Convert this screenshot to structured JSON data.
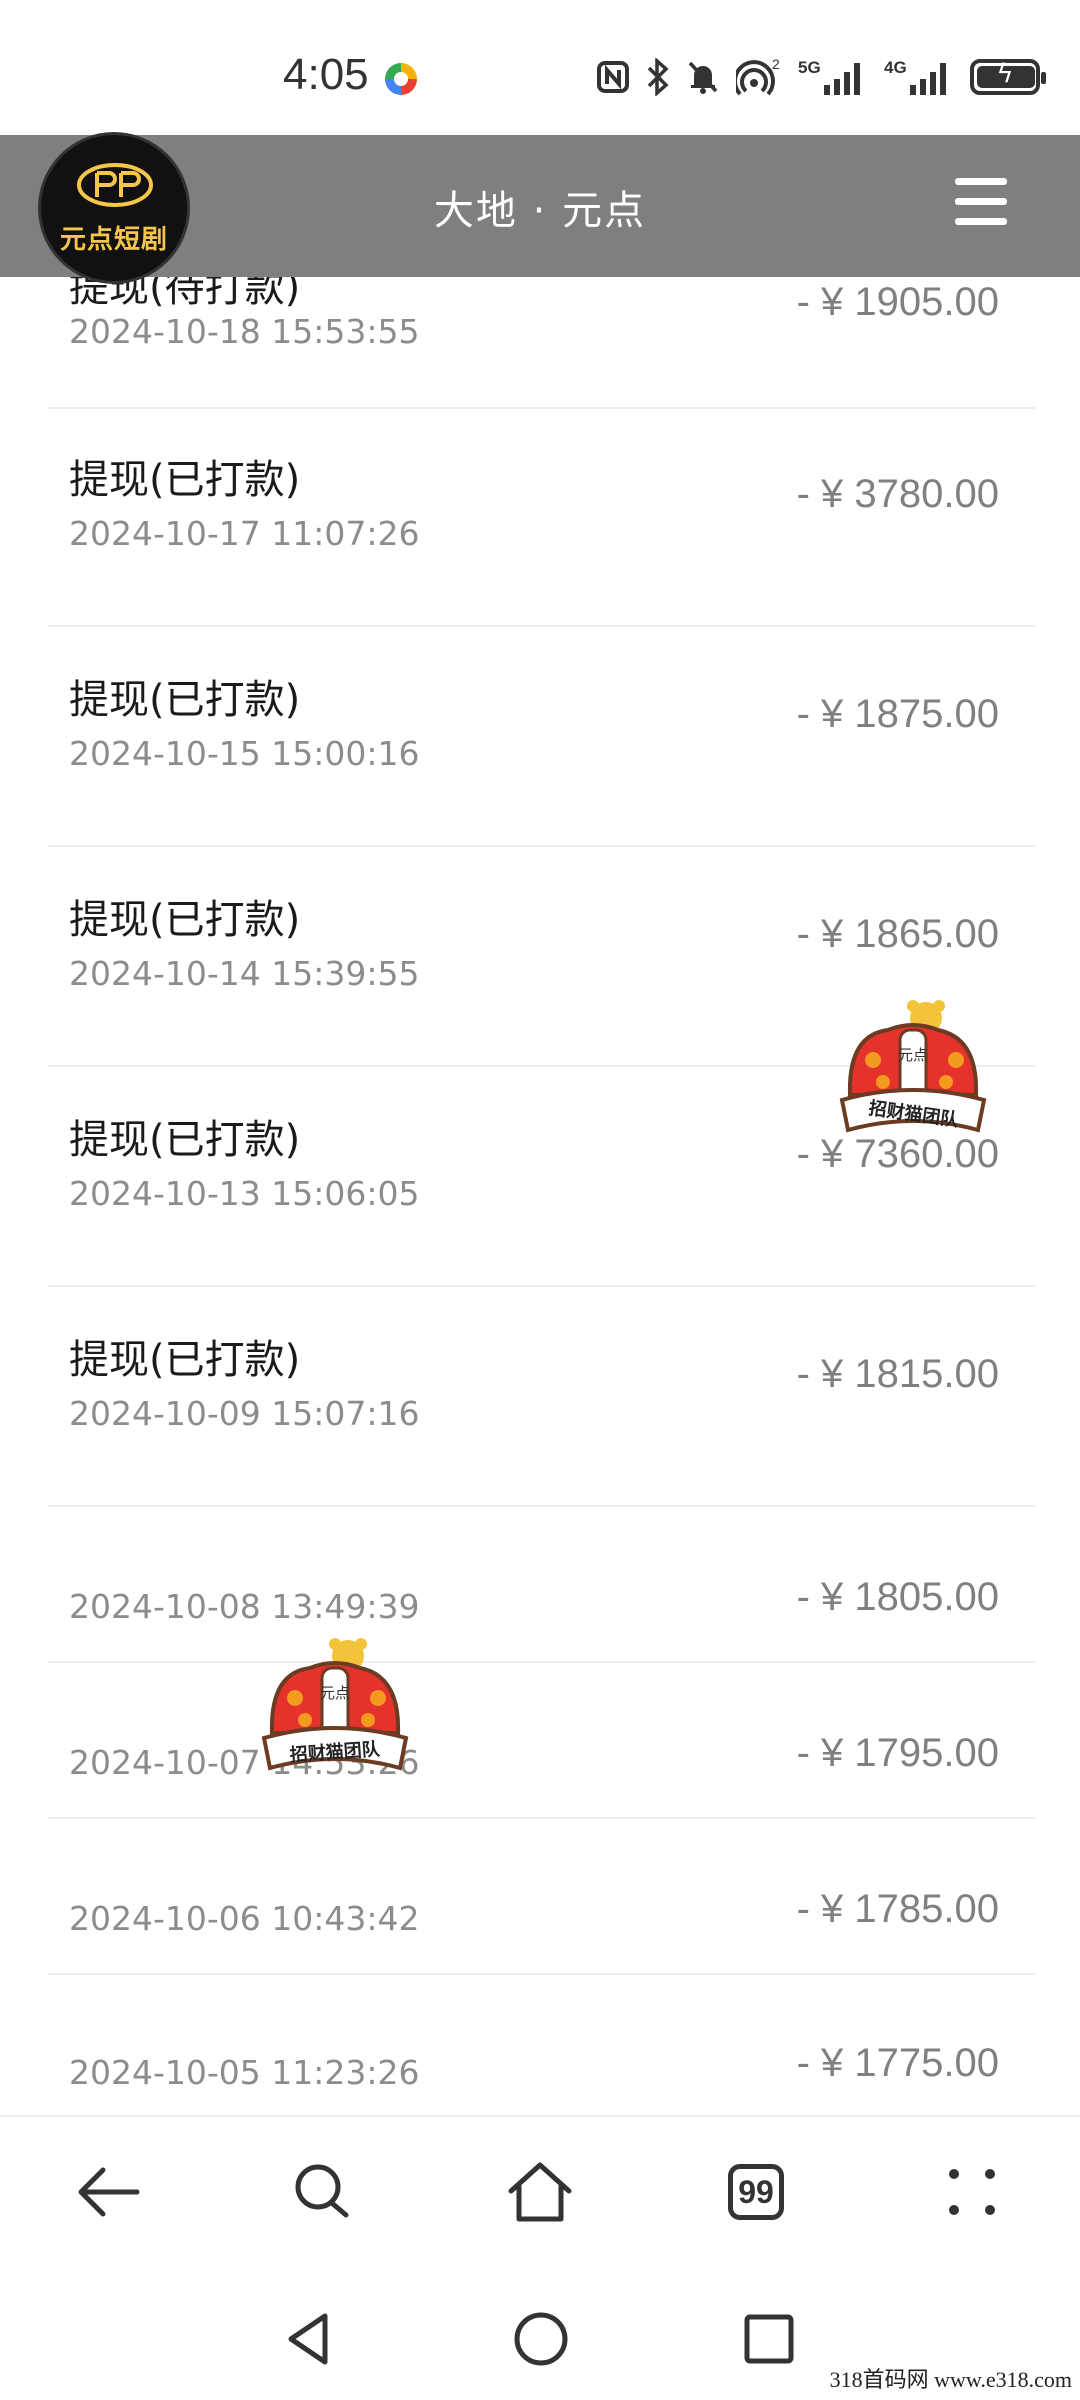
{
  "status_bar": {
    "time": "4:05",
    "signal_5g": "5G",
    "signal_4g": "4G",
    "hotspot_badge": "2"
  },
  "header": {
    "logo_text": "元点短剧",
    "title": "大地 · 元点"
  },
  "transactions": [
    {
      "title": "提现(待打款)",
      "date": "2024-10-18 15:53:55",
      "amount": "- ¥ 1905.00"
    },
    {
      "title": "提现(已打款)",
      "date": "2024-10-17 11:07:26",
      "amount": "- ¥ 3780.00"
    },
    {
      "title": "提现(已打款)",
      "date": "2024-10-15 15:00:16",
      "amount": "- ¥ 1875.00"
    },
    {
      "title": "提现(已打款)",
      "date": "2024-10-14 15:39:55",
      "amount": "- ¥ 1865.00"
    },
    {
      "title": "提现(已打款)",
      "date": "2024-10-13 15:06:05",
      "amount": "- ¥ 7360.00"
    },
    {
      "title": "提现(已打款)",
      "date": "2024-10-09 15:07:16",
      "amount": "- ¥ 1815.00"
    },
    {
      "title": "",
      "date": "2024-10-08 13:49:39",
      "amount": "- ¥ 1805.00"
    },
    {
      "title": "",
      "date": "2024-10-07 14:53:26",
      "amount": "- ¥ 1795.00"
    },
    {
      "title": "",
      "date": "2024-10-06 10:43:42",
      "amount": "- ¥ 1785.00"
    },
    {
      "title": "",
      "date": "2024-10-05 11:23:26",
      "amount": "- ¥ 1775.00"
    }
  ],
  "sticker": {
    "label": "招财猫团队",
    "crown_text": "元点"
  },
  "browser_bar": {
    "tab_count": "99"
  },
  "watermark": "318首码网   www.e318.com",
  "colors": {
    "header_bg": "#7f7f7f",
    "logo_gold": "#f6c64a",
    "amount_gray": "#808080"
  }
}
